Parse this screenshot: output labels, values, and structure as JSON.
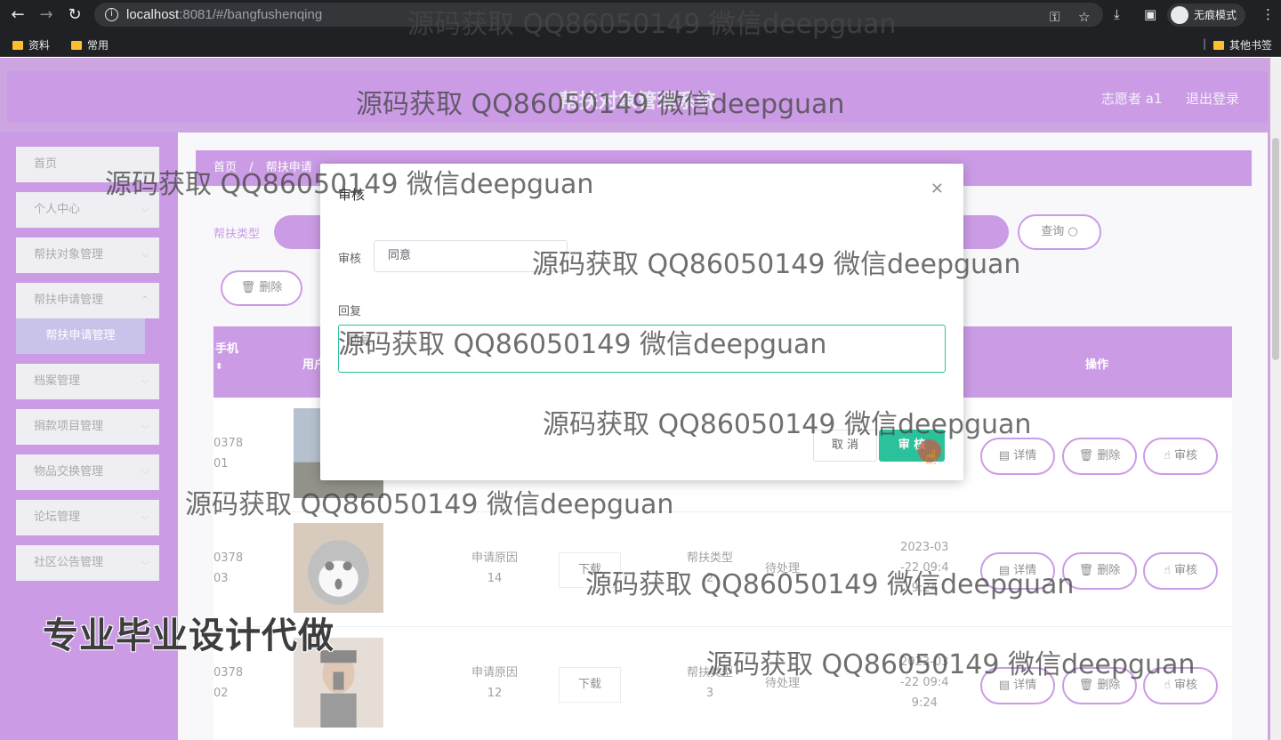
{
  "browser": {
    "url_host": "localhost",
    "url_rest": ":8081/#/bangfushenqing",
    "incognito_label": "无痕模式",
    "bookmarks": [
      "资料",
      "常用"
    ],
    "other_bookmarks": "其他书签"
  },
  "header": {
    "title": "帮扶对象管理系统",
    "user": "志愿者 a1",
    "logout": "退出登录"
  },
  "sidebar": {
    "items": [
      {
        "label": "首页"
      },
      {
        "label": "个人中心"
      },
      {
        "label": "帮扶对象管理"
      },
      {
        "label": "帮扶申请管理"
      },
      {
        "label": "档案管理"
      },
      {
        "label": "捐款项目管理"
      },
      {
        "label": "物品交换管理"
      },
      {
        "label": "论坛管理"
      },
      {
        "label": "社区公告管理"
      }
    ],
    "active_sub": "帮扶申请管理"
  },
  "main": {
    "breadcrumb_home": "首页",
    "breadcrumb_current": "帮扶申请",
    "search_label": "帮扶类型",
    "query_button": "查询",
    "delete_button": "删除",
    "columns": {
      "phone": "手机",
      "user": "用户",
      "ops": "操作"
    },
    "rows": [
      {
        "phone": "0378\n01",
        "reason": "",
        "type": "",
        "status": "",
        "time": ""
      },
      {
        "phone": "0378\n03",
        "reason": "申请原因\n14",
        "download": "下载",
        "type": "帮扶类型\n2",
        "status": "待处理",
        "time": "2023-03\n-22 09:4\n9:24"
      },
      {
        "phone": "0378\n02",
        "reason": "申请原因\n12",
        "download": "下载",
        "type": "帮扶类型\n3",
        "status": "待处理",
        "time": "2023-03\n-22 09:4\n9:24"
      }
    ],
    "ops": {
      "detail": "详情",
      "delete": "删除",
      "audit": "审核"
    }
  },
  "dialog": {
    "title": "审核",
    "audit_label": "审核",
    "audit_value": "同意",
    "reply_label": "回复",
    "reply_placeholder": "回复",
    "cancel": "取 消",
    "confirm": "审 核"
  },
  "watermarks": {
    "text": "源码获取 QQ86050149 微信deepguan",
    "big": "专业毕业设计代做"
  },
  "colors": {
    "brand": "#a04bd0",
    "confirm": "#2bc29b"
  }
}
